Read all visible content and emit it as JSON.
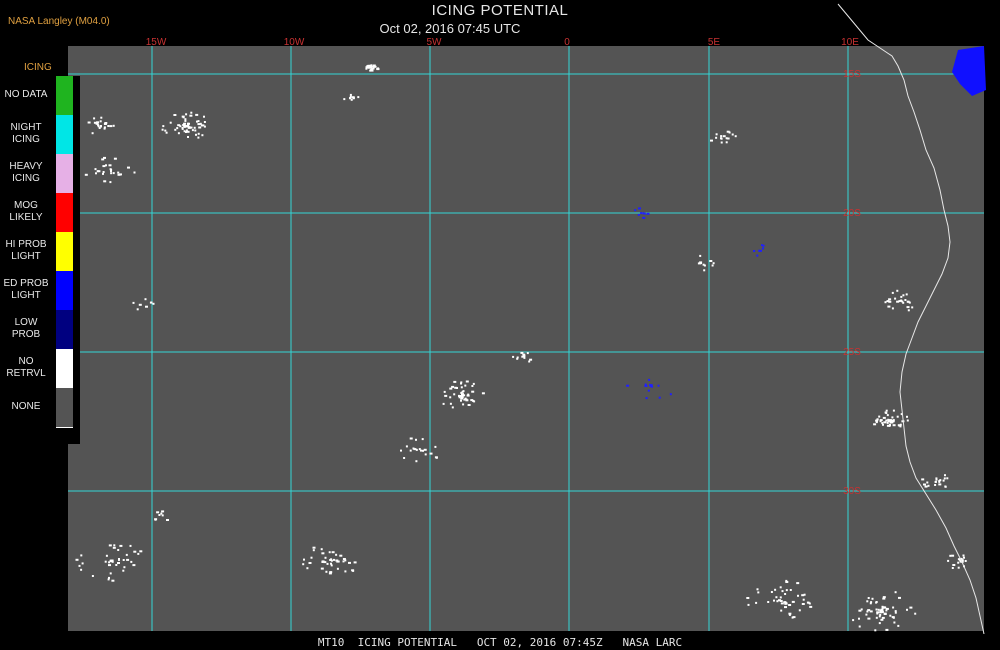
{
  "header": {
    "credit": "NASA Langley (M04.0)",
    "title": "ICING POTENTIAL",
    "subtitle": "Oct 02, 2016 07:45 UTC"
  },
  "map": {
    "longitude_labels": [
      "15W",
      "10W",
      "5W",
      "0",
      "5E",
      "10E"
    ],
    "latitude_labels": [
      "15S",
      "20S",
      "25S",
      "30S"
    ],
    "colors": {
      "background": "#545454",
      "grid": "#33d6d6",
      "coastline": "#e8e8e8",
      "grid_label": "#c83232"
    }
  },
  "legend": {
    "title": "ICING",
    "items": [
      {
        "label": "NO DATA",
        "color": "#1fb41f"
      },
      {
        "label": "NIGHT\nICING",
        "color": "#00e6e6"
      },
      {
        "label": "HEAVY\nICING",
        "color": "#e6b0e6"
      },
      {
        "label": "MOG\nLIKELY",
        "color": "#ff0000"
      },
      {
        "label": "HI PROB\nLIGHT",
        "color": "#ffff00"
      },
      {
        "label": "ED PROB\nLIGHT",
        "color": "#0000ff"
      },
      {
        "label": "LOW\nPROB",
        "color": "#000080"
      },
      {
        "label": "NO\nRETRVL",
        "color": "#ffffff"
      },
      {
        "label": "NONE",
        "color": "#545454"
      }
    ]
  },
  "footer": {
    "text": "MT10  ICING POTENTIAL   OCT 02, 2016 07:45Z   NASA LARC"
  }
}
